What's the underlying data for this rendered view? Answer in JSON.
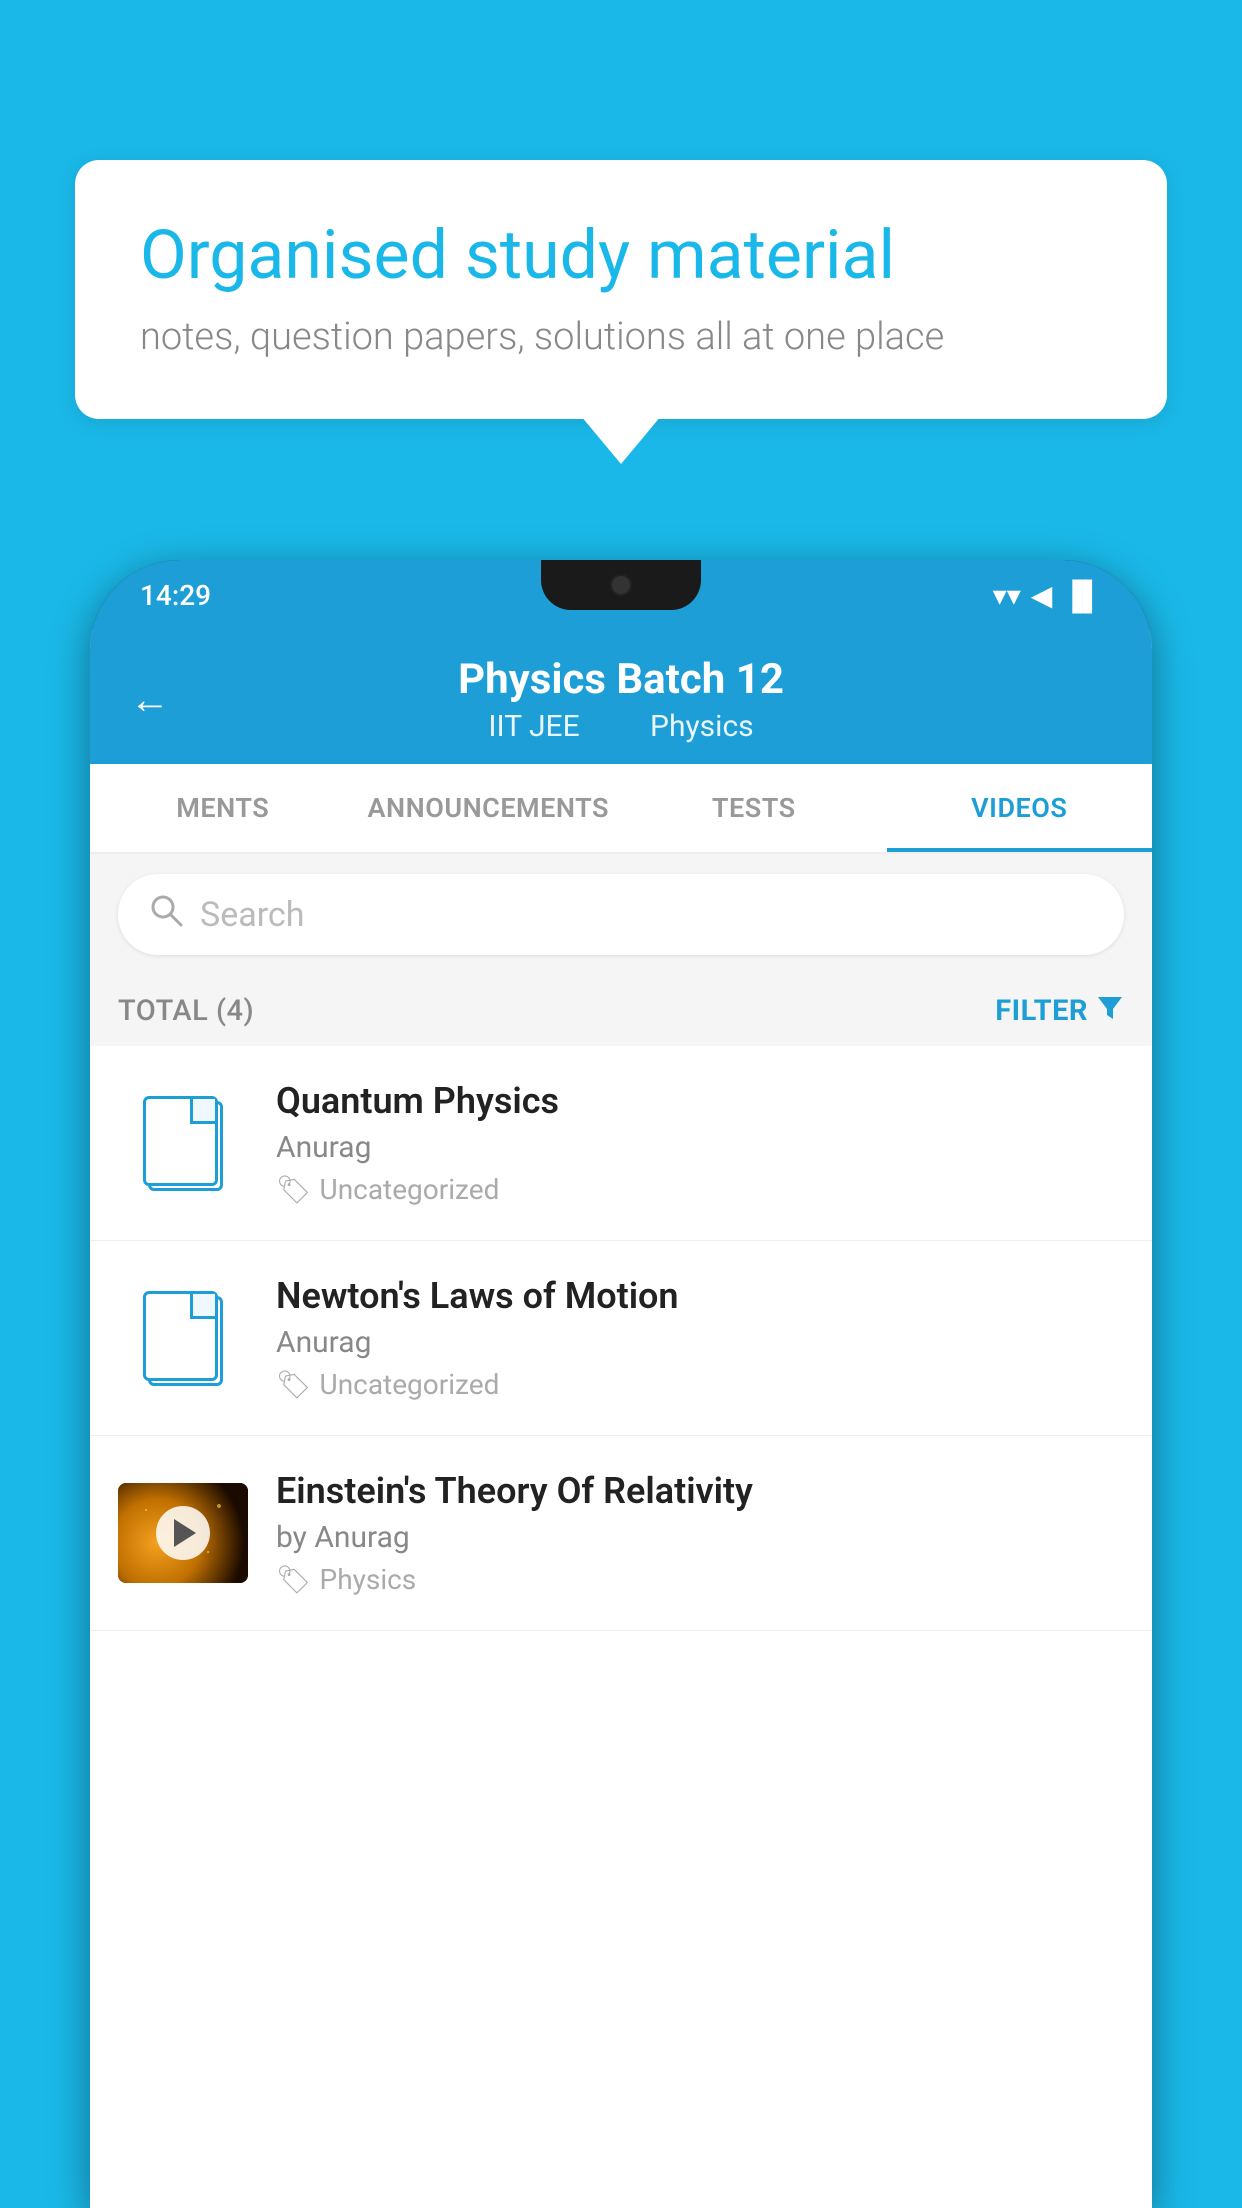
{
  "background_color": "#1ab8e8",
  "speech_bubble": {
    "title": "Organised study material",
    "subtitle": "notes, question papers, solutions all at one place"
  },
  "status_bar": {
    "time": "14:29",
    "wifi": "▼",
    "signal": "▲",
    "battery": "▮"
  },
  "app_header": {
    "back_label": "←",
    "title": "Physics Batch 12",
    "subtitle_part1": "IIT JEE",
    "subtitle_part2": "Physics"
  },
  "tabs": [
    {
      "label": "MENTS",
      "active": false
    },
    {
      "label": "ANNOUNCEMENTS",
      "active": false
    },
    {
      "label": "TESTS",
      "active": false
    },
    {
      "label": "VIDEOS",
      "active": true
    }
  ],
  "search": {
    "placeholder": "Search"
  },
  "filter": {
    "total_label": "TOTAL (4)",
    "filter_label": "FILTER"
  },
  "video_items": [
    {
      "title": "Quantum Physics",
      "author": "Anurag",
      "tag": "Uncategorized",
      "has_thumb": false
    },
    {
      "title": "Newton's Laws of Motion",
      "author": "Anurag",
      "tag": "Uncategorized",
      "has_thumb": false
    },
    {
      "title": "Einstein's Theory Of Relativity",
      "author": "by Anurag",
      "tag": "Physics",
      "has_thumb": true
    }
  ]
}
